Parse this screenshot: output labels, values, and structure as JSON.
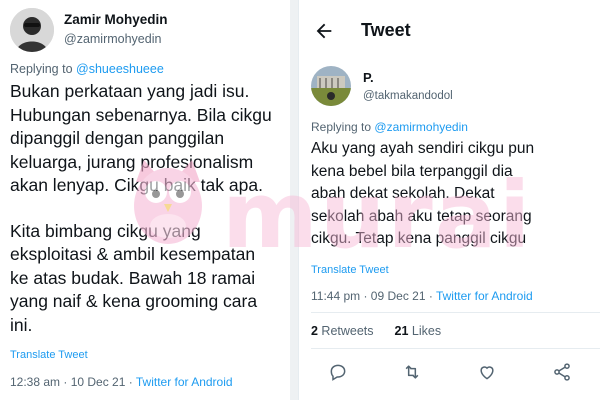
{
  "left": {
    "name": "Zamir Mohyedin",
    "handle": "@zamirmohyedin",
    "replying_label": "Replying to",
    "replying_to": "@shueeshueee",
    "body_lines_p1": [
      "Bukan perkataan yang jadi isu.",
      "Hubungan sebenarnya. Bila cikgu",
      "dipanggil dengan panggilan",
      "keluarga, jurang profesionalism",
      "akan lenyap. Cikgu baik tak apa."
    ],
    "body_lines_p2": [
      "Kita bimbang cikgu yang",
      "eksploitasi & ambil kesempatan",
      "ke atas budak. Bawah 18 ramai",
      "yang naif & kena grooming cara",
      "ini."
    ],
    "translate": "Translate Tweet",
    "time": "12:38 am · 10 Dec 21 · ",
    "source": "Twitter for Android"
  },
  "right": {
    "header_title": "Tweet",
    "name": "P.",
    "handle": "@takmakandodol",
    "replying_label": "Replying to",
    "replying_to": "@zamirmohyedin",
    "body_lines": [
      "Aku yang ayah sendiri cikgu pun",
      "kena bebel bila terpanggil dia",
      "abah dekat sekolah. Dekat",
      "sekolah abah aku tetap seorang",
      "cikgu. Tetap kena panggil cikgu"
    ],
    "translate": "Translate Tweet",
    "time": "11:44 pm · 09 Dec 21 · ",
    "source": "Twitter for Android",
    "retweets_count": "2",
    "retweets_label": " Retweets",
    "likes_count": "21",
    "likes_label": " Likes"
  },
  "watermark": {
    "text": "murai"
  },
  "icons": [
    "back-arrow-icon",
    "reply-icon",
    "retweet-icon",
    "like-icon",
    "share-icon"
  ],
  "colors": {
    "accent": "#1d9bf0",
    "text": "#0f1419",
    "muted": "#536471",
    "watermark": "#f6b8d6"
  }
}
